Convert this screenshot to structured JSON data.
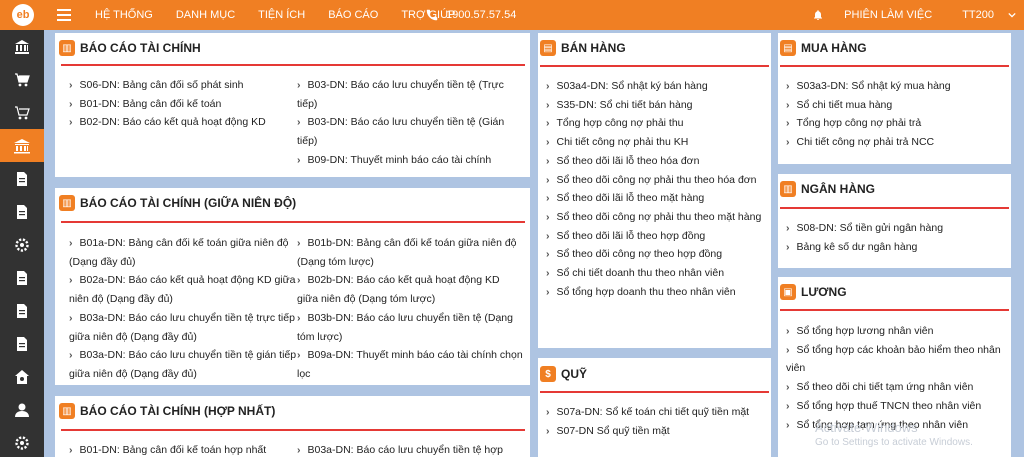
{
  "app": {
    "logo_text": "eb",
    "brand_color": "#f07f23",
    "sidebar_color": "#323232"
  },
  "topnav": {
    "items": [
      "HỆ THỐNG",
      "DANH MỤC",
      "TIỆN ÍCH",
      "BÁO CÁO",
      "TRỢ GIÚP"
    ],
    "phone": "1900.57.57.54",
    "session": "PHIÊN LÀM VIỆC",
    "user": "TT200"
  },
  "sidebar": {
    "items": [
      "bank-icon",
      "cart-icon",
      "cart-icon",
      "report-icon",
      "document-icon",
      "document-icon",
      "settings-icon",
      "document-icon",
      "document-icon",
      "document-icon",
      "home-icon",
      "user-icon",
      "settings-icon"
    ],
    "active_index": 3
  },
  "panels": {
    "bctc": {
      "title": "BÁO CÁO TÀI CHÍNH",
      "col1": [
        "S06-DN: Bảng cân đối số phát sinh",
        "B01-DN: Bảng cân đối kế toán",
        "B02-DN: Báo cáo kết quả hoạt động KD"
      ],
      "col2": [
        "B03-DN: Báo cáo lưu chuyển tiền tệ (Trực tiếp)",
        "B03-DN: Báo cáo lưu chuyển tiền tệ (Gián tiếp)",
        "B09-DN: Thuyết minh báo cáo tài chính"
      ]
    },
    "bctc_gnd": {
      "title": "BÁO CÁO TÀI CHÍNH (GIỮA NIÊN ĐỘ)",
      "col1": [
        "B01a-DN: Bảng cân đối kế toán giữa niên độ (Dạng đầy đủ)",
        "B02a-DN: Báo cáo kết quả hoạt động KD giữa niên độ (Dạng đầy đủ)",
        "B03a-DN: Báo cáo lưu chuyển tiền tệ trực tiếp giữa niên độ (Dạng đầy đủ)",
        "B03a-DN: Báo cáo lưu chuyển tiền tệ gián tiếp giữa niên độ (Dạng đầy đủ)"
      ],
      "col2": [
        "B01b-DN: Bảng cân đối kế toán giữa niên độ (Dạng tóm lược)",
        "B02b-DN: Báo cáo kết quả hoạt động KD giữa niên độ (Dạng tóm lược)",
        "B03b-DN: Báo cáo lưu chuyển tiền tệ (Dạng tóm lược)",
        "B09a-DN: Thuyết minh báo cáo tài chính chọn lọc"
      ]
    },
    "bctc_hn": {
      "title": "BÁO CÁO TÀI CHÍNH (HỢP NHẤT)",
      "col1": [
        "B01-DN: Bảng cân đối kế toán hợp nhất"
      ],
      "col2": [
        "B03a-DN: Báo cáo lưu chuyển tiền tệ hợp"
      ]
    },
    "banhang": {
      "title": "BÁN HÀNG",
      "items": [
        "S03a4-DN: Sổ nhật ký bán hàng",
        "S35-DN: Sổ chi tiết bán hàng",
        "Tổng hợp công nợ phải thu",
        "Chi tiết công nợ phải thu KH",
        "Sổ theo dõi lãi lỗ theo hóa đơn",
        "Sổ theo dõi công nợ phải thu theo hóa đơn",
        "Sổ theo dõi lãi lỗ theo mặt hàng",
        "Sổ theo dõi công nợ phải thu theo mặt hàng",
        "Sổ theo dõi lãi lỗ theo hợp đồng",
        "Sổ theo dõi công nợ theo hợp đồng",
        "Sổ chi tiết doanh thu theo nhân viên",
        "Sổ tổng hợp doanh thu theo nhân viên"
      ]
    },
    "quy": {
      "title": "QUỸ",
      "items": [
        "S07a-DN: Sổ kế toán chi tiết quỹ tiền mặt",
        "S07-DN Sổ quỹ tiền mặt"
      ]
    },
    "muahang": {
      "title": "MUA HÀNG",
      "items": [
        "S03a3-DN: Sổ nhật ký mua hàng",
        "Sổ chi tiết mua hàng",
        "Tổng hợp công nợ phải trả",
        "Chi tiết công nợ phải trả NCC"
      ]
    },
    "nganhang": {
      "title": "NGÂN HÀNG",
      "items": [
        "S08-DN: Sổ tiền gửi ngân hàng",
        "Bảng kê số dư ngân hàng"
      ]
    },
    "luong": {
      "title": "LƯƠNG",
      "items": [
        "Sổ tổng hợp lương nhân viên",
        "Sổ tổng hợp các khoản bảo hiểm theo nhân viên",
        "Sổ theo dõi chi tiết tạm ứng nhân viên",
        "Sổ tổng hợp thuế TNCN theo nhân viên",
        "Sổ tổng hợp tạm ứng theo nhân viên"
      ]
    }
  },
  "watermark": {
    "line1": "Activate Windows",
    "line2": "Go to Settings to activate Windows."
  }
}
